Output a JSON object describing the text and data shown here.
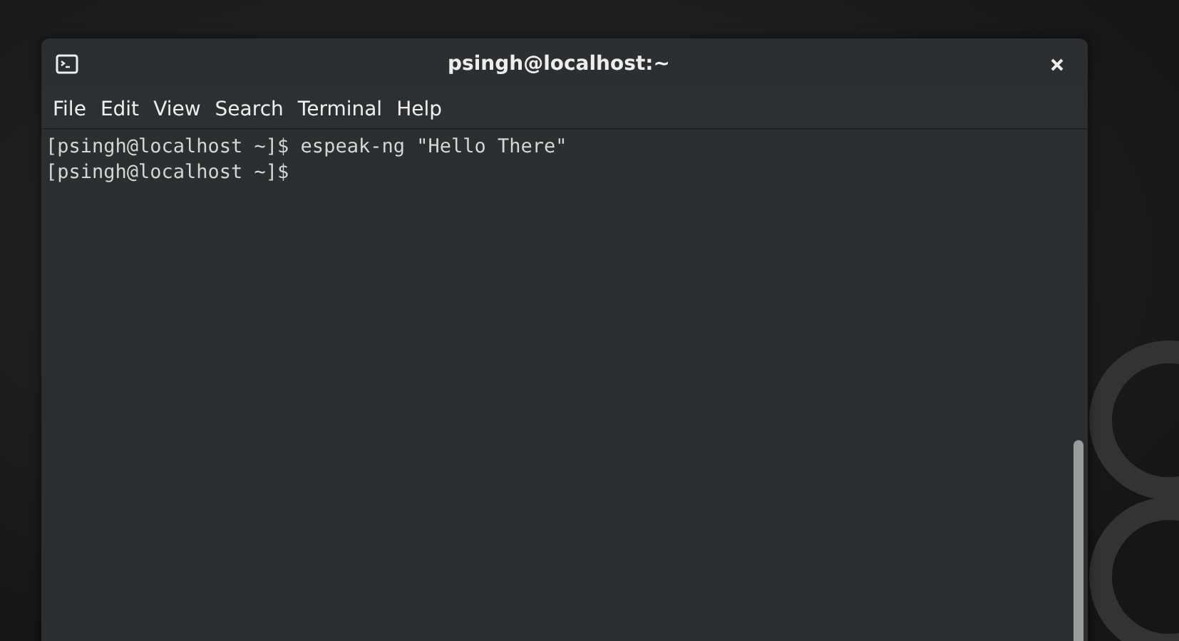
{
  "window": {
    "title": "psingh@localhost:~"
  },
  "menu": [
    "File",
    "Edit",
    "View",
    "Search",
    "Terminal",
    "Help"
  ],
  "terminal": {
    "lines": [
      "[psingh@localhost ~]$ espeak-ng \"Hello There\"",
      "[psingh@localhost ~]$"
    ]
  }
}
